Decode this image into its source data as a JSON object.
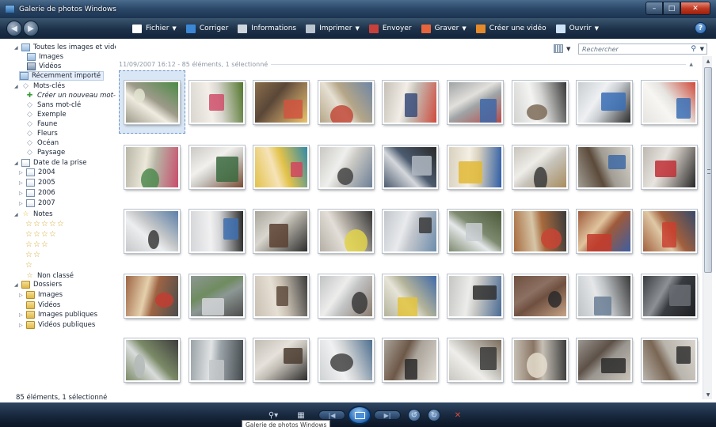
{
  "window": {
    "title": "Galerie de photos Windows",
    "controls": {
      "minimize": "–",
      "maximize": "□",
      "close": "✕"
    }
  },
  "toolbar": {
    "back_label": "◀",
    "forward_label": "▶",
    "items": [
      {
        "label": "Fichier",
        "icon": "file-icon",
        "color": "#ffffff",
        "has_caret": true
      },
      {
        "label": "Corriger",
        "icon": "fix-icon",
        "color": "#3c86d6",
        "has_caret": false
      },
      {
        "label": "Informations",
        "icon": "info-icon",
        "color": "#d0d6de",
        "has_caret": false
      },
      {
        "label": "Imprimer",
        "icon": "printer-icon",
        "color": "#b9c4cf",
        "has_caret": true
      },
      {
        "label": "Envoyer",
        "icon": "email-icon",
        "color": "#c9403a",
        "has_caret": false
      },
      {
        "label": "Graver",
        "icon": "burn-disc-icon",
        "color": "#e7643c",
        "has_caret": true
      },
      {
        "label": "Créer une vidéo",
        "icon": "movie-icon",
        "color": "#e48a2a",
        "has_caret": false
      },
      {
        "label": "Ouvrir",
        "icon": "open-icon",
        "color": "#cfe3f7",
        "has_caret": true
      }
    ],
    "help": "?"
  },
  "sidebar": {
    "all_media": "Toutes les images et vidéos",
    "images": "Images",
    "videos": "Vidéos",
    "recently_imported": "Récemment importé",
    "tags_header": "Mots-clés",
    "create_tag": "Créer un nouveau mot-clé",
    "untagged": "Sans mot-clé",
    "tags": [
      "Exemple",
      "Faune",
      "Fleurs",
      "Océan",
      "Paysage"
    ],
    "date_header": "Date de la prise",
    "years": [
      "2004",
      "2005",
      "2006",
      "2007"
    ],
    "ratings_header": "Notes",
    "ratings": [
      "☆☆☆☆☆",
      "☆☆☆☆",
      "☆☆☆",
      "☆☆",
      "☆"
    ],
    "unrated": "Non classé",
    "folders_header": "Dossiers",
    "folders": {
      "images": "Images",
      "videos": "Vidéos",
      "public_images": "Images publiques",
      "public_videos": "Vidéos publiques"
    }
  },
  "main": {
    "group_header": "11/09/2007 16:12 - 85 éléments, 1 sélectionné",
    "search_placeholder": "Rechercher",
    "selected_index": 0
  },
  "status": {
    "text": "85 éléments, 1 sélectionné"
  },
  "taskbar": {
    "tooltip": "Galerie de photos Windows"
  },
  "thumbnails": [
    {
      "palette": [
        "#9d9a8a",
        "#e2e4d0",
        "#4c8a46",
        "#f0ece0"
      ]
    },
    {
      "palette": [
        "#d9d6cf",
        "#cf4e6a",
        "#53762d",
        "#f3efe8"
      ]
    },
    {
      "palette": [
        "#8a6e4d",
        "#d0533f",
        "#e8c36b",
        "#5a4737"
      ]
    },
    {
      "palette": [
        "#b5a688",
        "#c24a39",
        "#6e86a5",
        "#e6e0d3"
      ]
    },
    {
      "palette": [
        "#c5c0b7",
        "#3a4c7a",
        "#d04a3d",
        "#f2eee7"
      ]
    },
    {
      "palette": [
        "#9fa3a5",
        "#3e67a8",
        "#b84a48",
        "#e2e0dc"
      ]
    },
    {
      "palette": [
        "#d3d3d1",
        "#7c6a56",
        "#383838",
        "#f4f4f2"
      ]
    },
    {
      "palette": [
        "#c9cdd1",
        "#3a6fb6",
        "#2c2c2c",
        "#eef0f2"
      ]
    },
    {
      "palette": [
        "#e5e4e0",
        "#3b6fb5",
        "#d04a3a",
        "#f7f6f2"
      ]
    },
    {
      "palette": [
        "#b8b6a6",
        "#4f8a4f",
        "#c94d6c",
        "#ece8da"
      ]
    },
    {
      "palette": [
        "#cbc9c4",
        "#3b6b40",
        "#7a4c33",
        "#f2f0ec"
      ]
    },
    {
      "palette": [
        "#e2c24a",
        "#d4445e",
        "#2f8aa8",
        "#f6e3b8"
      ]
    },
    {
      "palette": [
        "#c9c8c3",
        "#444",
        "#6d7f96",
        "#efefed"
      ]
    },
    {
      "palette": [
        "#4b5a6e",
        "#b0b8c2",
        "#2a2a2a",
        "#d5d8dc"
      ]
    },
    {
      "palette": [
        "#d9d1bf",
        "#e2b935",
        "#2f5ea6",
        "#f4efe4"
      ]
    },
    {
      "palette": [
        "#c7c4bc",
        "#3b3b3b",
        "#a88c5e",
        "#efede8"
      ]
    },
    {
      "palette": [
        "#a19d94",
        "#3e6aa4",
        "#d8d5ce",
        "#5b4a3a"
      ]
    },
    {
      "palette": [
        "#bdb7b0",
        "#c02f35",
        "#262626",
        "#e8e5e0"
      ]
    },
    {
      "palette": [
        "#c6c8c9",
        "#3a3a3a",
        "#5b7fa8",
        "#eceeef"
      ]
    },
    {
      "palette": [
        "#d5d6d8",
        "#3d6fb0",
        "#2a2a2a",
        "#f1f1f2"
      ]
    },
    {
      "palette": [
        "#a8a59c",
        "#5a4030",
        "#2d2d2d",
        "#d9d6cf"
      ]
    },
    {
      "palette": [
        "#b4aea5",
        "#e0d24a",
        "#343434",
        "#e3dfd8"
      ]
    },
    {
      "palette": [
        "#c2c6cc",
        "#3a3a3a",
        "#6c8cab",
        "#e8eaec"
      ]
    },
    {
      "palette": [
        "#7e8a6f",
        "#c7ccd0",
        "#4c5a3b",
        "#e5e8ea"
      ]
    },
    {
      "palette": [
        "#a76a3d",
        "#c94434",
        "#3b3b3b",
        "#d6c6a8"
      ]
    },
    {
      "palette": [
        "#9e5a3a",
        "#c43b2d",
        "#3e5ea2",
        "#e0c49e"
      ]
    },
    {
      "palette": [
        "#a25f3d",
        "#c9402f",
        "#364a6a",
        "#dfc9a6"
      ]
    },
    {
      "palette": [
        "#9d6444",
        "#c23d31",
        "#4c4c4c",
        "#e5d0ac"
      ]
    },
    {
      "palette": [
        "#8c9794",
        "#d4d6d8",
        "#4d4d4d",
        "#6f8c5f"
      ]
    },
    {
      "palette": [
        "#c9c0b2",
        "#5e4b3c",
        "#3c3c3c",
        "#e6dfd4"
      ]
    },
    {
      "palette": [
        "#c2c3c4",
        "#3a3a3a",
        "#8a7c70",
        "#ededec"
      ]
    },
    {
      "palette": [
        "#b3b39a",
        "#e2c33d",
        "#3f6aa8",
        "#e6e4d8"
      ]
    },
    {
      "palette": [
        "#c5c6c3",
        "#2f2f2f",
        "#4a6b94",
        "#ecedea"
      ]
    },
    {
      "palette": [
        "#6f5040",
        "#2a2a2a",
        "#c7a488",
        "#8c7062"
      ]
    },
    {
      "palette": [
        "#bfc3c6",
        "#6a7e94",
        "#383838",
        "#e5e7e9"
      ]
    },
    {
      "palette": [
        "#393c40",
        "#6a6e74",
        "#1f2124",
        "#8d9196"
      ]
    },
    {
      "palette": [
        "#7b8a67",
        "#b4bab9",
        "#3d3d3d",
        "#d9dcdc"
      ]
    },
    {
      "palette": [
        "#9aa3a8",
        "#c3c7c9",
        "#444a4e",
        "#e1e3e4"
      ]
    },
    {
      "palette": [
        "#c1bcb4",
        "#4b3c30",
        "#2a2a2a",
        "#e6e2db"
      ]
    },
    {
      "palette": [
        "#d0d3d5",
        "#434343",
        "#4e6f8f",
        "#f0f1f2"
      ]
    },
    {
      "palette": [
        "#aaa49b",
        "#2c2c2c",
        "#e0dbd3",
        "#6d5848"
      ]
    },
    {
      "palette": [
        "#c9c7c1",
        "#3a3a3a",
        "#7c6e5c",
        "#efeeea"
      ]
    },
    {
      "palette": [
        "#c6c0b5",
        "#e4dccd",
        "#3d3d3d",
        "#8a7564"
      ]
    },
    {
      "palette": [
        "#9a9690",
        "#2c2c2c",
        "#c8c2b8",
        "#5d5147"
      ]
    },
    {
      "palette": [
        "#b9b5ad",
        "#303030",
        "#d9d5ce",
        "#7a6654"
      ]
    }
  ]
}
